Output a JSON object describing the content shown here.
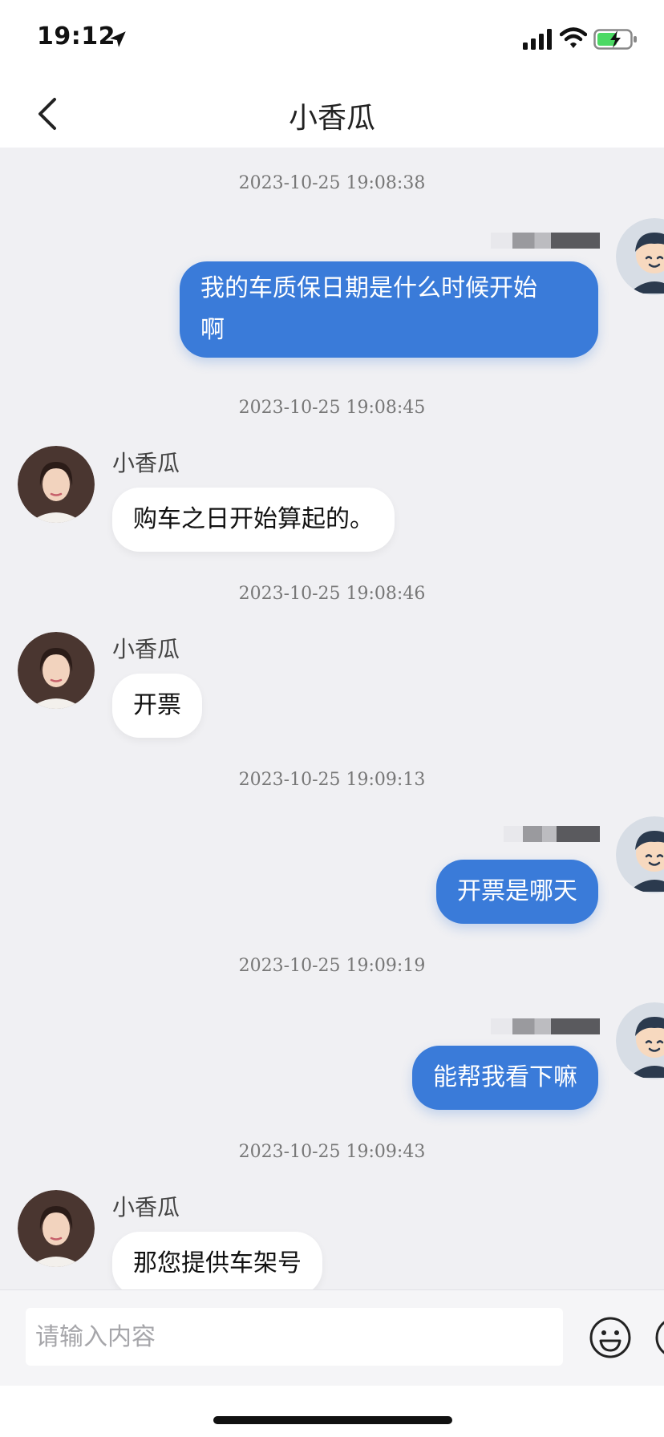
{
  "status_bar": {
    "time": "19:12",
    "icons": [
      "location-arrow-icon",
      "cellular-signal-icon",
      "wifi-icon",
      "battery-charging-icon"
    ],
    "battery_color": "#4cd964"
  },
  "header": {
    "title": "小香瓜",
    "back_icon": "chevron-left-icon"
  },
  "colors": {
    "outgoing_bubble": "#3a7bd9",
    "incoming_bubble": "#ffffff",
    "chat_background": "#f0f0f3"
  },
  "messages": [
    {
      "timestamp": "2023-10-25 19:08:38",
      "direction": "outgoing",
      "text_lines": [
        "我的车质保日期是什么时候开始",
        "啊"
      ]
    },
    {
      "timestamp": "2023-10-25 19:08:45",
      "direction": "incoming",
      "sender": "小香瓜",
      "text": "购车之日开始算起的。"
    },
    {
      "timestamp": "2023-10-25 19:08:46",
      "direction": "incoming",
      "sender": "小香瓜",
      "text": "开票"
    },
    {
      "timestamp": "2023-10-25 19:09:13",
      "direction": "outgoing",
      "text": "开票是哪天"
    },
    {
      "timestamp": "2023-10-25 19:09:19",
      "direction": "outgoing",
      "text": "能帮我看下嘛"
    },
    {
      "timestamp": "2023-10-25 19:09:43",
      "direction": "incoming",
      "sender": "小香瓜",
      "text": "那您提供车架号"
    }
  ],
  "input": {
    "placeholder": "请输入内容",
    "value": ""
  },
  "input_icons": [
    "emoji-icon",
    "add-icon"
  ]
}
